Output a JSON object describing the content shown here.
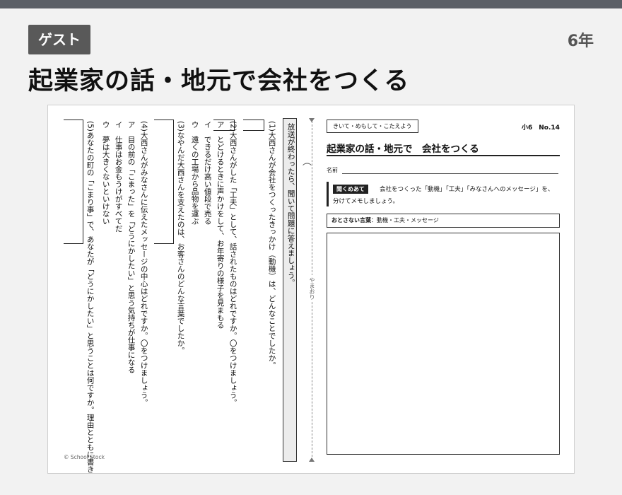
{
  "header": {
    "badge": "ゲスト",
    "grade": "6年",
    "title": "起業家の話・地元で会社をつくる"
  },
  "sheet": {
    "instruction": "放送が終わったら、聞いて問題に答えましょう。",
    "questions": [
      {
        "number": "(1)",
        "text": "大西さんが会社をつくったきっかけ（動機）は、どんなことでしたか。",
        "options": []
      },
      {
        "number": "(2)",
        "text": "大西さんがした「工夫」として、話されたものはどれですか。〇をつけましょう。",
        "options": [
          "ア　とどけるときに声かけをして、お年寄りの様子を見まもる",
          "イ　できるだけ高い値段で売る",
          "ウ　遠くの工場から品物を運ぶ"
        ]
      },
      {
        "number": "(3)",
        "text": "なやんだ大西さんを支えたのは、お客さんのどんな言葉でしたか。",
        "options": []
      },
      {
        "number": "(4)",
        "text": "大西さんがみなさんに伝えたメッセージの中心はどれですか。〇をつけましょう。",
        "options": [
          "ア　目の前の「こまった」を「どうにかしたい」と思う気持ちが仕事になる",
          "イ　仕事はお金もうけがすべてだ",
          "ウ　夢は大きくないといけない"
        ]
      },
      {
        "number": "(5)",
        "text": "あなたの町の「こまり事」で、あなたが「どうにかしたい」と思うことは何ですか。理由とともに書きましょう。",
        "options": []
      }
    ],
    "fold_label": "やまおり",
    "copyright": "© School Stock",
    "subject": "きいて・めもして・こたえよう",
    "worksheet_no": "小6　No.14",
    "title": "起業家の話・地元で　会社をつくる",
    "name_label": "名前",
    "task_tag": "聞くめあて",
    "task_line1": "会社をつくった「動機」「工夫」「みなさんへのメッセージ」を、",
    "task_line2": "分けてメモしましょう。",
    "keywords_label": "おとさない言葉",
    "keywords": "：動機・工夫・メッセージ"
  }
}
